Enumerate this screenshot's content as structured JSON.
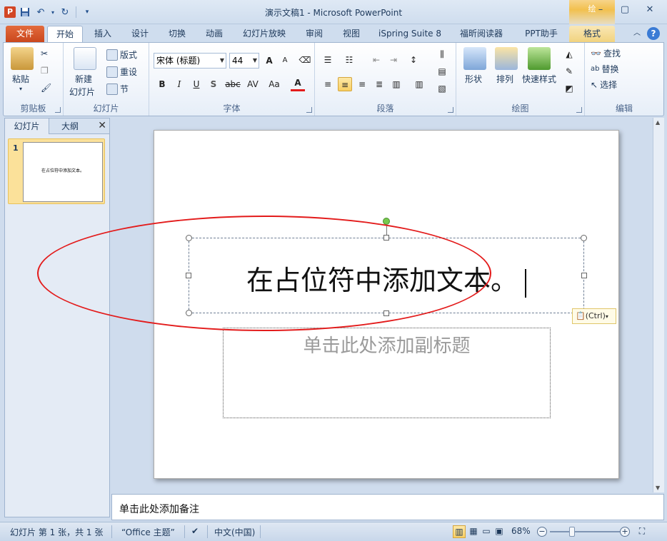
{
  "window": {
    "title": "演示文稿1 - Microsoft PowerPoint",
    "app_icon": "P",
    "context_tab_label": "绘"
  },
  "qat": {
    "icons": [
      "save-icon",
      "undo-icon",
      "redo-icon",
      "customize-icon"
    ]
  },
  "tabs": {
    "file": "文件",
    "home": "开始",
    "insert": "插入",
    "design": "设计",
    "transitions": "切换",
    "animations": "动画",
    "slideshow": "幻灯片放映",
    "review": "审阅",
    "view": "视图",
    "ispring": "iSpring Suite 8",
    "foxit": "福昕阅读器",
    "ppt_helper": "PPT助手",
    "format": "格式"
  },
  "ribbon": {
    "clipboard": {
      "paste": "粘贴",
      "label": "剪贴板"
    },
    "slides": {
      "new_slide_1": "新建",
      "new_slide_2": "幻灯片",
      "layout": "版式",
      "reset": "重设",
      "section": "节",
      "label": "幻灯片"
    },
    "font": {
      "name": "宋体 (标题)",
      "size": "44",
      "bold": "B",
      "italic": "I",
      "underline": "U",
      "shadow": "S",
      "strike": "abc",
      "spacing": "AV",
      "case": "Aa",
      "color": "A",
      "grow": "A",
      "shrink": "A",
      "label": "字体"
    },
    "paragraph": {
      "label": "段落"
    },
    "drawing": {
      "shapes": "形状",
      "arrange": "排列",
      "quick_styles": "快速样式",
      "label": "绘图"
    },
    "editing": {
      "find": "查找",
      "replace": "替换",
      "select": "选择",
      "label": "编辑"
    }
  },
  "left_pane": {
    "tab_slides": "幻灯片",
    "tab_outline": "大纲",
    "close": "✕",
    "thumbnail_number": "1",
    "thumbnail_text": "在占位符中添加文本。"
  },
  "slide": {
    "title_text": "在占位符中添加文本。",
    "subtitle_placeholder": "单击此处添加副标题",
    "paste_options": "(Ctrl)"
  },
  "notes": {
    "placeholder": "单击此处添加备注"
  },
  "status": {
    "slide_info": "幻灯片 第 1 张，共 1 张",
    "theme": "“Office 主题”",
    "language": "中文(中国)",
    "zoom": "68%",
    "zoom_minus": "−",
    "zoom_plus": "+"
  },
  "colors": {
    "file_tab": "#d24625",
    "selection_highlight": "#f8cf63",
    "annotation_ellipse": "#e31b1b",
    "rotate_handle": "#78c94f"
  }
}
